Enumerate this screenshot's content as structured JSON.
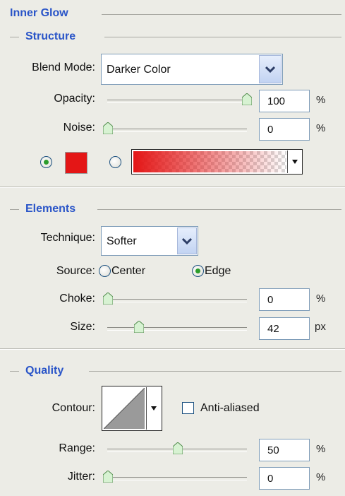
{
  "colors": {
    "section_title": "#2a55c8",
    "glow_color": "#e41616",
    "select_border": "#7f9db9"
  },
  "panel": {
    "title": "Inner Glow"
  },
  "structure": {
    "title": "Structure",
    "blend_mode": {
      "label": "Blend Mode:",
      "value": "Darker Color",
      "icon": "chevron-down-icon"
    },
    "opacity": {
      "label": "Opacity:",
      "value": "100",
      "unit": "%",
      "slider_fraction": 1.0
    },
    "noise": {
      "label": "Noise:",
      "value": "0",
      "unit": "%",
      "slider_fraction": 0.0
    },
    "fill": {
      "mode_selected": "color",
      "color": "#e41616",
      "gradient_from": "#e41616",
      "gradient_to": "transparent"
    }
  },
  "elements": {
    "title": "Elements",
    "technique": {
      "label": "Technique:",
      "value": "Softer"
    },
    "source": {
      "label": "Source:",
      "options": [
        "Center",
        "Edge"
      ],
      "selected": "Edge"
    },
    "choke": {
      "label": "Choke:",
      "value": "0",
      "unit": "%",
      "slider_fraction": 0.0
    },
    "size": {
      "label": "Size:",
      "value": "42",
      "unit": "px",
      "slider_fraction": 0.17
    }
  },
  "quality": {
    "title": "Quality",
    "contour": {
      "label": "Contour:"
    },
    "anti_aliased": {
      "label": "Anti-aliased",
      "checked": false
    },
    "range": {
      "label": "Range:",
      "value": "50",
      "unit": "%",
      "slider_fraction": 0.5
    },
    "jitter": {
      "label": "Jitter:",
      "value": "0",
      "unit": "%",
      "slider_fraction": 0.0
    }
  }
}
